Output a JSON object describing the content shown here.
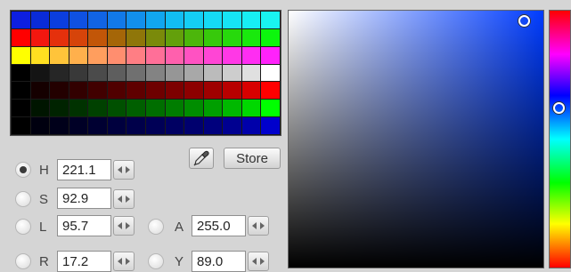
{
  "palette": [
    [
      "#0d1fe0",
      "#0a2bd8",
      "#0b3ede",
      "#0f51e2",
      "#1164e4",
      "#1279e8",
      "#128fec",
      "#11a6ef",
      "#12bdf2",
      "#14cef4",
      "#15daf5",
      "#16e4f5",
      "#17eef4",
      "#19f4f1"
    ],
    [
      "#ff0000",
      "#f3170f",
      "#e5300c",
      "#d6440a",
      "#c25608",
      "#a56608",
      "#8f7609",
      "#7a8a0a",
      "#63a00b",
      "#4cb60b",
      "#37c90b",
      "#27d90c",
      "#19e90d",
      "#0cf60d"
    ],
    [
      "#ffff00",
      "#ffe020",
      "#ffc43a",
      "#ffb04c",
      "#ff9e5e",
      "#ff8e6f",
      "#ff7e84",
      "#ff6f98",
      "#ff60ad",
      "#ff52c2",
      "#ff45d5",
      "#ff38e6",
      "#ff2df2",
      "#ff22fb"
    ],
    [
      "#000000",
      "#141414",
      "#262626",
      "#393939",
      "#4b4b4b",
      "#5e5e5e",
      "#707070",
      "#838383",
      "#969696",
      "#a8a8a8",
      "#bbbbbb",
      "#cdcdcd",
      "#e0e0e0",
      "#ffffff"
    ],
    [
      "#000000",
      "#150000",
      "#230000",
      "#320000",
      "#410000",
      "#500000",
      "#5f0000",
      "#6e0000",
      "#7d0000",
      "#8d0000",
      "#9f0000",
      "#b80000",
      "#d80000",
      "#ff0000"
    ],
    [
      "#000000",
      "#001500",
      "#002300",
      "#003200",
      "#004100",
      "#005000",
      "#005f00",
      "#006e00",
      "#007d00",
      "#008d00",
      "#009f00",
      "#00b800",
      "#00d800",
      "#00ff00"
    ],
    [
      "#000000",
      "#00000f",
      "#00001a",
      "#000026",
      "#000032",
      "#00003e",
      "#00004a",
      "#000056",
      "#000062",
      "#00006e",
      "#00007d",
      "#000090",
      "#0000aa",
      "#0000cc"
    ]
  ],
  "toolbar": {
    "picker_icon": "eyedropper-icon",
    "store_label": "Store"
  },
  "fields": {
    "h": {
      "label": "H",
      "value": "221.1",
      "checked": true
    },
    "s": {
      "label": "S",
      "value": "92.9",
      "checked": false
    },
    "l": {
      "label": "L",
      "value": "95.7",
      "checked": false
    },
    "a": {
      "label": "A",
      "value": "255.0",
      "checked": false
    },
    "r": {
      "label": "R",
      "value": "17.2",
      "checked": false
    },
    "y": {
      "label": "Y",
      "value": "89.0",
      "checked": false
    }
  },
  "sv_area": {
    "hue_color": "#003cff"
  },
  "colors": {
    "panel_bg": "#d5d5d5",
    "marker": "#ffffff"
  }
}
